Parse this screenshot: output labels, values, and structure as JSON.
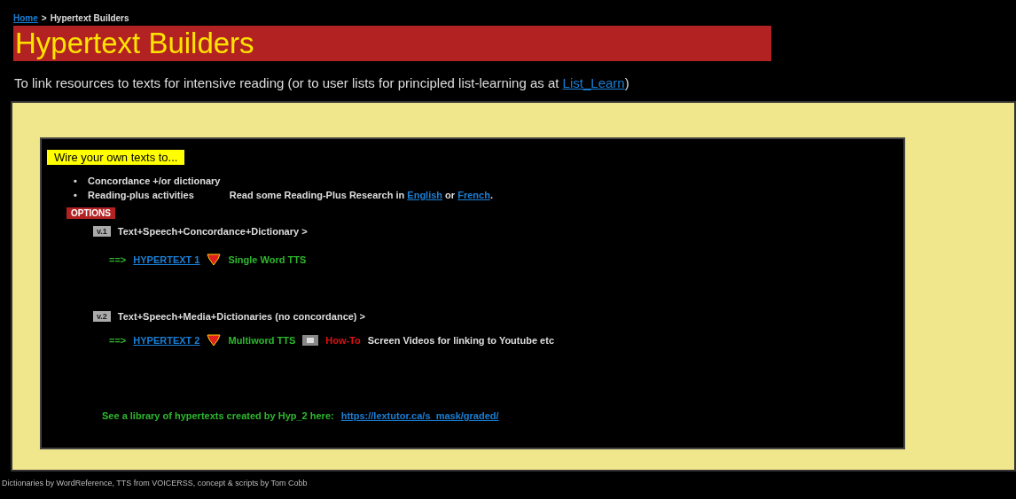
{
  "breadcrumb": {
    "link": "Home",
    "separator": ">",
    "current": "Hypertext Builders"
  },
  "title": "Hypertext Builders",
  "intro": {
    "text": "To link resources to texts for intensive reading (or to user lists for principled list-learning as at ",
    "link": "List_Learn",
    "after": ")"
  },
  "panel": {
    "heading": "Wire your own texts to...",
    "bullets": [
      {
        "marker": "•",
        "text": "Concordance +/or dictionary"
      },
      {
        "marker": "•",
        "text": "Reading-plus activities",
        "note": "Read some Reading-Plus Research in ",
        "links": [
          "English",
          "French"
        ],
        "joiner": " or ",
        "end": "."
      }
    ],
    "options_label": "OPTIONS",
    "options": [
      {
        "badge": "v.1",
        "title": "Text+Speech+Concordance+Dictionary >",
        "arrow": "==>",
        "link": "HYPERTEXT 1",
        "tts": "Single Word TTS"
      },
      {
        "badge": "v.2",
        "title": "Text+Speech+Media+Dictionaries (no concordance) >",
        "arrow": "==>",
        "link": "HYPERTEXT 2",
        "tts": "Multiword TTS",
        "howto": "How-To",
        "howto_note": "Screen Videos for linking to Youtube etc"
      }
    ],
    "library": {
      "text": "See a library of hypertexts created by Hyp_2 here:",
      "link": "https://lextutor.ca/s_mask/graded/"
    }
  },
  "footer": "Dictionaries by WordReference, TTS from VOICERSS, concept & scripts by Tom Cobb"
}
